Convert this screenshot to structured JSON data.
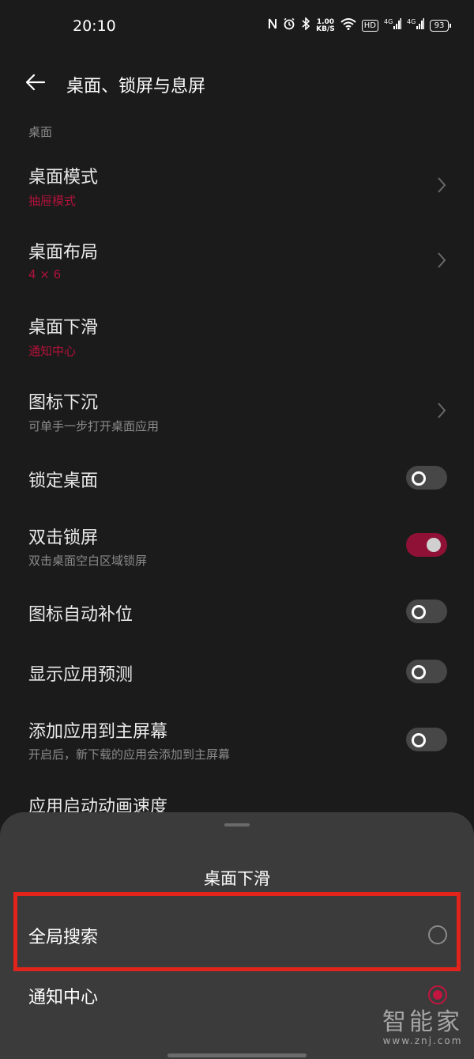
{
  "status_bar": {
    "time": "20:10",
    "icons": [
      "nfc-icon",
      "alarm-icon",
      "bluetooth-icon",
      "network-speed",
      "wifi-icon",
      "hd-icon",
      "signal-4g-icon",
      "signal-4g-icon",
      "battery-icon"
    ],
    "speed_value": "1.00",
    "speed_unit": "KB/S",
    "hd_label": "HD",
    "net1": "4G",
    "net2": "4G",
    "battery": "93"
  },
  "header": {
    "title": "桌面、锁屏与息屏"
  },
  "section": {
    "label": "桌面"
  },
  "items": [
    {
      "title": "桌面模式",
      "subtitle": "抽屉模式"
    },
    {
      "title": "桌面布局",
      "subtitle": "4 × 6"
    },
    {
      "title": "桌面下滑",
      "subtitle": "通知中心"
    },
    {
      "title": "图标下沉",
      "subtitle": "可单手一步打开桌面应用"
    },
    {
      "title": "锁定桌面",
      "toggle": false
    },
    {
      "title": "双击锁屏",
      "subtitle": "双击桌面空白区域锁屏",
      "toggle": true
    },
    {
      "title": "图标自动补位",
      "toggle": false
    },
    {
      "title": "显示应用预测",
      "toggle": false
    },
    {
      "title": "添加应用到主屏幕",
      "subtitle": "开启后，新下载的应用会添加到主屏幕",
      "toggle": false
    },
    {
      "title": "应用启动动画速度"
    }
  ],
  "sheet": {
    "title": "桌面下滑",
    "options": [
      {
        "label": "全局搜索",
        "selected": false
      },
      {
        "label": "通知中心",
        "selected": true
      }
    ]
  },
  "watermark": {
    "main": "智能家",
    "url": "www.znj.com"
  },
  "colors": {
    "background": "#1b1b1b",
    "accent": "#b0123a",
    "sheet": "#3b3b3b",
    "highlight": "#e3241c"
  }
}
